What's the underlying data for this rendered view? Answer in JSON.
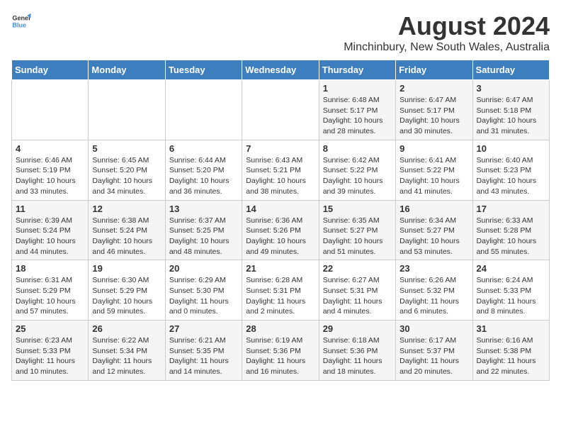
{
  "header": {
    "logo_general": "General",
    "logo_blue": "Blue",
    "main_title": "August 2024",
    "subtitle": "Minchinbury, New South Wales, Australia"
  },
  "weekdays": [
    "Sunday",
    "Monday",
    "Tuesday",
    "Wednesday",
    "Thursday",
    "Friday",
    "Saturday"
  ],
  "weeks": [
    [
      {
        "day": "",
        "info": ""
      },
      {
        "day": "",
        "info": ""
      },
      {
        "day": "",
        "info": ""
      },
      {
        "day": "",
        "info": ""
      },
      {
        "day": "1",
        "info": "Sunrise: 6:48 AM\nSunset: 5:17 PM\nDaylight: 10 hours\nand 28 minutes."
      },
      {
        "day": "2",
        "info": "Sunrise: 6:47 AM\nSunset: 5:17 PM\nDaylight: 10 hours\nand 30 minutes."
      },
      {
        "day": "3",
        "info": "Sunrise: 6:47 AM\nSunset: 5:18 PM\nDaylight: 10 hours\nand 31 minutes."
      }
    ],
    [
      {
        "day": "4",
        "info": "Sunrise: 6:46 AM\nSunset: 5:19 PM\nDaylight: 10 hours\nand 33 minutes."
      },
      {
        "day": "5",
        "info": "Sunrise: 6:45 AM\nSunset: 5:20 PM\nDaylight: 10 hours\nand 34 minutes."
      },
      {
        "day": "6",
        "info": "Sunrise: 6:44 AM\nSunset: 5:20 PM\nDaylight: 10 hours\nand 36 minutes."
      },
      {
        "day": "7",
        "info": "Sunrise: 6:43 AM\nSunset: 5:21 PM\nDaylight: 10 hours\nand 38 minutes."
      },
      {
        "day": "8",
        "info": "Sunrise: 6:42 AM\nSunset: 5:22 PM\nDaylight: 10 hours\nand 39 minutes."
      },
      {
        "day": "9",
        "info": "Sunrise: 6:41 AM\nSunset: 5:22 PM\nDaylight: 10 hours\nand 41 minutes."
      },
      {
        "day": "10",
        "info": "Sunrise: 6:40 AM\nSunset: 5:23 PM\nDaylight: 10 hours\nand 43 minutes."
      }
    ],
    [
      {
        "day": "11",
        "info": "Sunrise: 6:39 AM\nSunset: 5:24 PM\nDaylight: 10 hours\nand 44 minutes."
      },
      {
        "day": "12",
        "info": "Sunrise: 6:38 AM\nSunset: 5:24 PM\nDaylight: 10 hours\nand 46 minutes."
      },
      {
        "day": "13",
        "info": "Sunrise: 6:37 AM\nSunset: 5:25 PM\nDaylight: 10 hours\nand 48 minutes."
      },
      {
        "day": "14",
        "info": "Sunrise: 6:36 AM\nSunset: 5:26 PM\nDaylight: 10 hours\nand 49 minutes."
      },
      {
        "day": "15",
        "info": "Sunrise: 6:35 AM\nSunset: 5:27 PM\nDaylight: 10 hours\nand 51 minutes."
      },
      {
        "day": "16",
        "info": "Sunrise: 6:34 AM\nSunset: 5:27 PM\nDaylight: 10 hours\nand 53 minutes."
      },
      {
        "day": "17",
        "info": "Sunrise: 6:33 AM\nSunset: 5:28 PM\nDaylight: 10 hours\nand 55 minutes."
      }
    ],
    [
      {
        "day": "18",
        "info": "Sunrise: 6:31 AM\nSunset: 5:29 PM\nDaylight: 10 hours\nand 57 minutes."
      },
      {
        "day": "19",
        "info": "Sunrise: 6:30 AM\nSunset: 5:29 PM\nDaylight: 10 hours\nand 59 minutes."
      },
      {
        "day": "20",
        "info": "Sunrise: 6:29 AM\nSunset: 5:30 PM\nDaylight: 11 hours\nand 0 minutes."
      },
      {
        "day": "21",
        "info": "Sunrise: 6:28 AM\nSunset: 5:31 PM\nDaylight: 11 hours\nand 2 minutes."
      },
      {
        "day": "22",
        "info": "Sunrise: 6:27 AM\nSunset: 5:31 PM\nDaylight: 11 hours\nand 4 minutes."
      },
      {
        "day": "23",
        "info": "Sunrise: 6:26 AM\nSunset: 5:32 PM\nDaylight: 11 hours\nand 6 minutes."
      },
      {
        "day": "24",
        "info": "Sunrise: 6:24 AM\nSunset: 5:33 PM\nDaylight: 11 hours\nand 8 minutes."
      }
    ],
    [
      {
        "day": "25",
        "info": "Sunrise: 6:23 AM\nSunset: 5:33 PM\nDaylight: 11 hours\nand 10 minutes."
      },
      {
        "day": "26",
        "info": "Sunrise: 6:22 AM\nSunset: 5:34 PM\nDaylight: 11 hours\nand 12 minutes."
      },
      {
        "day": "27",
        "info": "Sunrise: 6:21 AM\nSunset: 5:35 PM\nDaylight: 11 hours\nand 14 minutes."
      },
      {
        "day": "28",
        "info": "Sunrise: 6:19 AM\nSunset: 5:36 PM\nDaylight: 11 hours\nand 16 minutes."
      },
      {
        "day": "29",
        "info": "Sunrise: 6:18 AM\nSunset: 5:36 PM\nDaylight: 11 hours\nand 18 minutes."
      },
      {
        "day": "30",
        "info": "Sunrise: 6:17 AM\nSunset: 5:37 PM\nDaylight: 11 hours\nand 20 minutes."
      },
      {
        "day": "31",
        "info": "Sunrise: 6:16 AM\nSunset: 5:38 PM\nDaylight: 11 hours\nand 22 minutes."
      }
    ]
  ]
}
